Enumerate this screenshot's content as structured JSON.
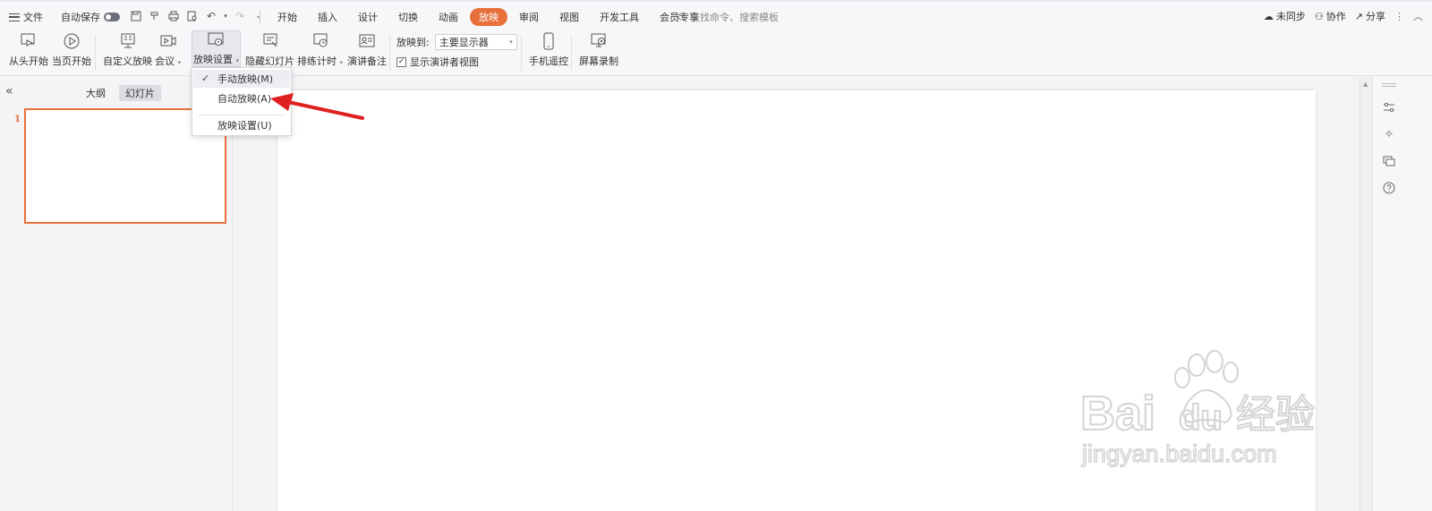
{
  "topbar": {
    "file_label": "文件",
    "autosave_label": "自动保存",
    "tabs": [
      {
        "label": "开始"
      },
      {
        "label": "插入"
      },
      {
        "label": "设计"
      },
      {
        "label": "切换"
      },
      {
        "label": "动画"
      },
      {
        "label": "放映",
        "active": true
      },
      {
        "label": "审阅"
      },
      {
        "label": "视图"
      },
      {
        "label": "开发工具"
      },
      {
        "label": "会员专享"
      }
    ],
    "search_placeholder": "查找命令、搜索模板",
    "sync_label": "未同步",
    "collab_label": "协作",
    "share_label": "分享"
  },
  "ribbon": {
    "from_start": "从头开始",
    "from_current": "当页开始",
    "custom_show": "自定义放映",
    "meeting": "会议",
    "show_settings": "放映设置",
    "hide_slide": "隐藏幻灯片",
    "rehearse": "排练计时",
    "speaker_notes": "演讲备注",
    "play_to_label": "放映到:",
    "play_to_value": "主要显示器",
    "presenter_view": "显示演讲者视图",
    "presenter_view_checked": true,
    "phone_remote": "手机遥控",
    "screen_record": "屏幕录制"
  },
  "dropdown": {
    "items": [
      {
        "label": "手动放映(M)",
        "checked": true
      },
      {
        "label": "自动放映(A)",
        "checked": false
      },
      {
        "label": "放映设置(U)",
        "checked": false
      }
    ]
  },
  "left_panel": {
    "tab_outline": "大纲",
    "tab_slides": "幻灯片",
    "slide_number": "1"
  },
  "watermark": {
    "brand": "Baidu经验",
    "url": "jingyan.baidu.com"
  },
  "colors": {
    "accent": "#e8703a",
    "annotation_arrow": "#e02020"
  }
}
